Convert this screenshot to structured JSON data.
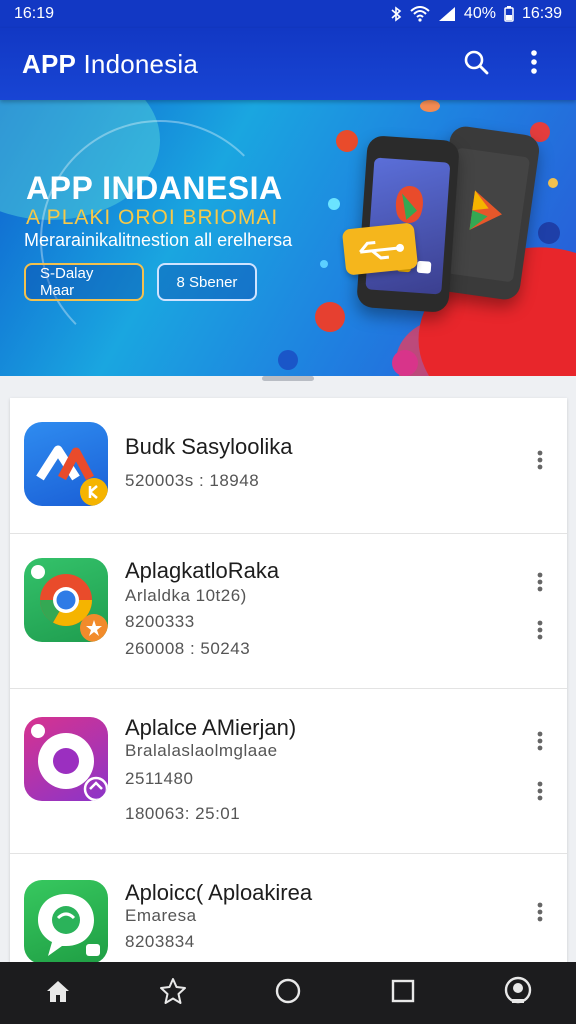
{
  "status_bar": {
    "time": "16:19",
    "battery": "40%",
    "clock_right": "16:39"
  },
  "app_bar": {
    "title_bold": "APP",
    "title_rest": " Indonesia",
    "icons": [
      "search-icon",
      "more-vert-icon"
    ]
  },
  "banner": {
    "headline": "APP INDANESIA",
    "subtitle": "A PLAKI OROI BRIOMAI",
    "tagline": "Merarainikalitnestion all erelhersa",
    "button_primary": "S-Dalay Maar",
    "button_secondary": "8 Sbener",
    "colors": {
      "accent": "#f2c14e",
      "primary": "#1238c4"
    }
  },
  "apps": [
    {
      "name": "Budk Sasyloolika",
      "lines": [
        "520003s : 18948"
      ],
      "icon": "app-icon-blue"
    },
    {
      "name": "AplagkatloRaka",
      "lines": [
        "Arlaldka 10t26)",
        "8200333",
        "260008 : 50243"
      ],
      "icon": "app-icon-chrome"
    },
    {
      "name": "Aplalce AMierjan)",
      "lines": [
        "Bralalaslaolmglaae",
        "2511480",
        "180063: 25:01"
      ],
      "icon": "app-icon-purple"
    },
    {
      "name": "Aploicc( Aploakirea",
      "lines": [
        "Emaresa",
        "8203834"
      ],
      "icon": "app-icon-green"
    }
  ],
  "nav_bar": {
    "items": [
      "home-icon",
      "star-icon",
      "circle-icon",
      "square-icon",
      "account-icon"
    ]
  }
}
